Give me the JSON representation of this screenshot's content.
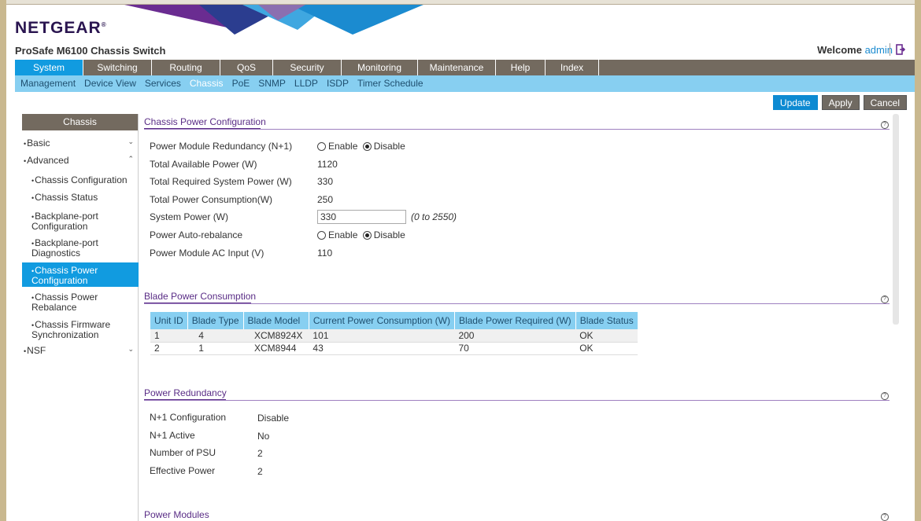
{
  "brand": {
    "logo": "NETGEAR",
    "logo_mark": "®",
    "product": "ProSafe M6100 Chassis Switch",
    "welcome_prefix": "Welcome",
    "user": "admin"
  },
  "mainnav": [
    {
      "label": "System",
      "active": true
    },
    {
      "label": "Switching"
    },
    {
      "label": "Routing"
    },
    {
      "label": "QoS"
    },
    {
      "label": "Security"
    },
    {
      "label": "Monitoring"
    },
    {
      "label": "Maintenance"
    },
    {
      "label": "Help"
    },
    {
      "label": "Index"
    }
  ],
  "subnav": [
    {
      "label": "Management"
    },
    {
      "label": "Device View"
    },
    {
      "label": "Services"
    },
    {
      "label": "Chassis",
      "active": true
    },
    {
      "label": "PoE"
    },
    {
      "label": "SNMP"
    },
    {
      "label": "LLDP"
    },
    {
      "label": "ISDP"
    },
    {
      "label": "Timer Schedule"
    }
  ],
  "actions": {
    "update": "Update",
    "apply": "Apply",
    "cancel": "Cancel"
  },
  "sidebar": {
    "header": "Chassis",
    "basic": "Basic",
    "advanced": "Advanced",
    "items": [
      "Chassis Configuration",
      "Chassis Status",
      "Backplane-port Configuration",
      "Backplane-port Diagnostics",
      "Chassis Power Configuration",
      "Chassis Power Rebalance",
      "Chassis Firmware Synchronization"
    ],
    "nsf": "NSF"
  },
  "power_config": {
    "title": "Chassis Power Configuration",
    "redundancy_label": "Power Module Redundancy (N+1)",
    "enable": "Enable",
    "disable": "Disable",
    "total_available_label": "Total Available Power (W)",
    "total_available": "1120",
    "total_required_label": "Total Required System Power (W)",
    "total_required": "330",
    "total_consumption_label": "Total Power Consumption(W)",
    "total_consumption": "250",
    "system_power_label": "System Power (W)",
    "system_power": "330",
    "system_power_range": "(0 to 2550)",
    "auto_rebalance_label": "Power Auto-rebalance",
    "ac_input_label": "Power Module AC Input (V)",
    "ac_input": "110"
  },
  "blade_power": {
    "title": "Blade Power Consumption",
    "columns": [
      "Unit ID",
      "Blade Type",
      "Blade Model",
      "Current Power Consumption (W)",
      "Blade Power Required (W)",
      "Blade Status"
    ],
    "rows": [
      [
        "1",
        "4",
        "XCM8924X",
        "101",
        "200",
        "OK"
      ],
      [
        "2",
        "1",
        "XCM8944",
        "43",
        "70",
        "OK"
      ]
    ]
  },
  "power_redundancy": {
    "title": "Power Redundancy",
    "config_label": "N+1 Configuration",
    "config": "Disable",
    "active_label": "N+1 Active",
    "active": "No",
    "psu_label": "Number of PSU",
    "psu": "2",
    "effective_label": "Effective Power",
    "effective": "2"
  },
  "power_modules": {
    "title": "Power Modules"
  },
  "help_glyph": "?"
}
